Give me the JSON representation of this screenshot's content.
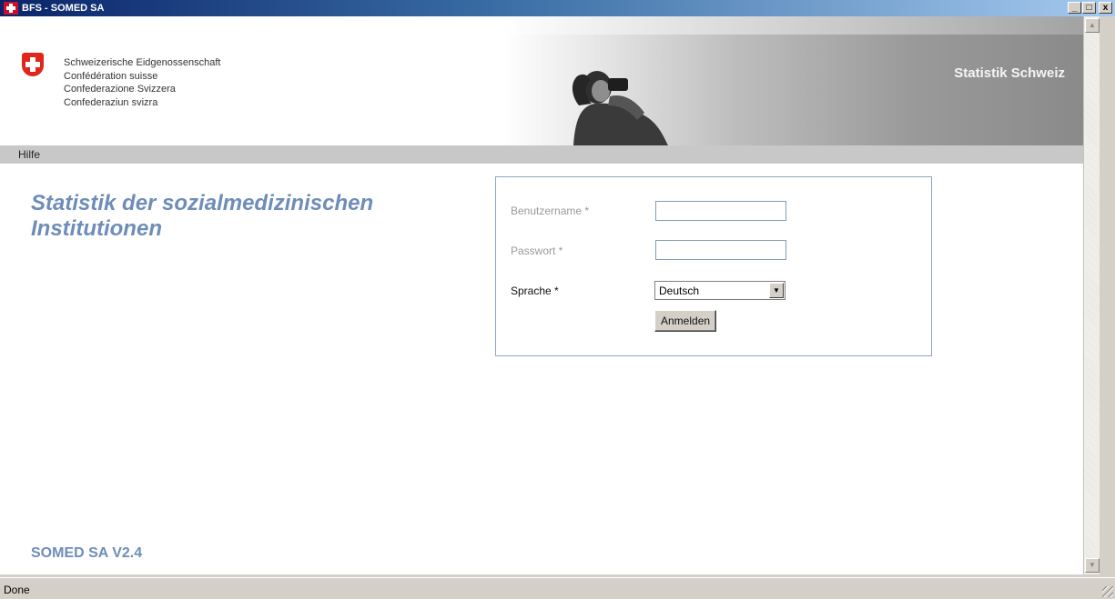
{
  "window": {
    "title": "BFS - SOMED SA",
    "minimize": "_",
    "maximize": "□",
    "close": "x"
  },
  "header": {
    "confederation_lines": [
      "Schweizerische Eidgenossenschaft",
      "Confédération suisse",
      "Confederazione Svizzera",
      "Confederaziun svizra"
    ],
    "banner_title": "Statistik Schweiz"
  },
  "nav": {
    "help": "Hilfe"
  },
  "main": {
    "title_line1": "Statistik der sozialmedizinischen",
    "title_line2": "Institutionen",
    "version": "SOMED  SA V2.4"
  },
  "login": {
    "username_label": "Benutzername *",
    "username_value": "",
    "password_label": "Passwort *",
    "password_value": "",
    "language_label": "Sprache *",
    "language_selected": "Deutsch",
    "submit_label": "Anmelden"
  },
  "status": {
    "text": "Done"
  },
  "colors": {
    "accent_blue": "#6e8db8",
    "swiss_red": "#e1251b",
    "nav_gray": "#c8c8c8"
  }
}
